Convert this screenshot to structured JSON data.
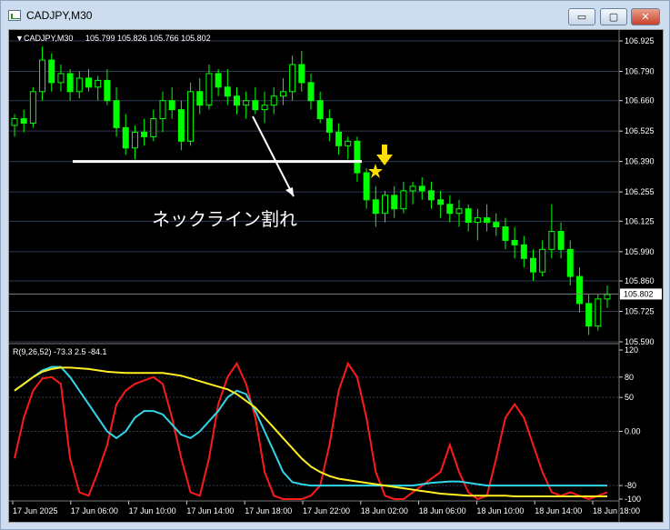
{
  "window": {
    "title": "CADJPY,M30",
    "min_label": "▭",
    "max_label": "▢",
    "close_label": "✕"
  },
  "colors": {
    "bull": "#00ff00",
    "bear": "#000000",
    "grid": "#2e3b54",
    "red": "#ff1a1a",
    "cyan": "#33d6e6",
    "yellow": "#ffee22",
    "white": "#ffffff"
  },
  "chart": {
    "symbol_label": "CADJPY,M30",
    "ohlc": "105.799 105.826 105.766 105.802",
    "current_price": "105.802",
    "annotation": "ネックライン割れ",
    "price_ticks": [
      "106.925",
      "106.790",
      "106.660",
      "106.525",
      "106.390",
      "106.255",
      "106.125",
      "105.990",
      "105.860",
      "105.725",
      "105.590"
    ],
    "indicator_label": "R(9,26,52) -73.3 2.5 -84.1",
    "indicator_ticks": [
      "120",
      "80",
      "50",
      "0.00",
      "-80",
      "-100"
    ],
    "time_ticks": [
      "17 Jun 2025",
      "17 Jun 06:00",
      "17 Jun 10:00",
      "17 Jun 14:00",
      "17 Jun 18:00",
      "17 Jun 22:00",
      "18 Jun 02:00",
      "18 Jun 06:00",
      "18 Jun 10:00",
      "18 Jun 14:00",
      "18 Jun 18:00"
    ]
  },
  "chart_data": {
    "type": "candlestick",
    "symbol": "CADJPY",
    "timeframe": "M30",
    "ylim": [
      105.59,
      106.925
    ],
    "neckline": 106.39,
    "candles": [
      [
        106.55,
        106.6,
        106.5,
        106.58
      ],
      [
        106.58,
        106.62,
        106.52,
        106.56
      ],
      [
        106.56,
        106.72,
        106.54,
        106.7
      ],
      [
        106.7,
        106.9,
        106.66,
        106.84
      ],
      [
        106.84,
        106.87,
        106.7,
        106.74
      ],
      [
        106.74,
        106.82,
        106.7,
        106.78
      ],
      [
        106.78,
        106.8,
        106.66,
        106.7
      ],
      [
        106.7,
        106.79,
        106.67,
        106.76
      ],
      [
        106.76,
        106.8,
        106.7,
        106.72
      ],
      [
        106.72,
        106.77,
        106.66,
        106.75
      ],
      [
        106.75,
        106.8,
        106.64,
        106.66
      ],
      [
        106.66,
        106.72,
        106.5,
        106.54
      ],
      [
        106.54,
        106.6,
        106.42,
        106.45
      ],
      [
        106.45,
        106.55,
        106.4,
        106.52
      ],
      [
        106.52,
        106.58,
        106.46,
        106.5
      ],
      [
        106.5,
        106.62,
        106.48,
        106.58
      ],
      [
        106.58,
        106.7,
        106.52,
        106.66
      ],
      [
        106.66,
        106.72,
        106.58,
        106.62
      ],
      [
        106.62,
        106.66,
        106.44,
        106.48
      ],
      [
        106.48,
        106.74,
        106.46,
        106.7
      ],
      [
        106.7,
        106.76,
        106.6,
        106.64
      ],
      [
        106.64,
        106.82,
        106.62,
        106.78
      ],
      [
        106.78,
        106.8,
        106.68,
        106.72
      ],
      [
        106.72,
        106.8,
        106.64,
        106.68
      ],
      [
        106.68,
        106.72,
        106.6,
        106.64
      ],
      [
        106.64,
        106.7,
        106.58,
        106.66
      ],
      [
        106.66,
        106.72,
        106.6,
        106.62
      ],
      [
        106.62,
        106.7,
        106.56,
        106.64
      ],
      [
        106.64,
        106.72,
        106.6,
        106.68
      ],
      [
        106.68,
        106.76,
        106.64,
        106.7
      ],
      [
        106.7,
        106.86,
        106.66,
        106.82
      ],
      [
        106.82,
        106.88,
        106.7,
        106.74
      ],
      [
        106.74,
        106.78,
        106.62,
        106.66
      ],
      [
        106.66,
        106.7,
        106.56,
        106.58
      ],
      [
        106.58,
        106.62,
        106.48,
        106.52
      ],
      [
        106.52,
        106.56,
        106.42,
        106.46
      ],
      [
        106.46,
        106.5,
        106.4,
        106.48
      ],
      [
        106.48,
        106.5,
        106.3,
        106.34
      ],
      [
        106.34,
        106.36,
        106.18,
        106.22
      ],
      [
        106.22,
        106.28,
        106.1,
        106.16
      ],
      [
        106.16,
        106.26,
        106.12,
        106.24
      ],
      [
        106.24,
        106.28,
        106.14,
        106.18
      ],
      [
        106.18,
        106.3,
        106.16,
        106.26
      ],
      [
        106.26,
        106.3,
        106.2,
        106.28
      ],
      [
        106.28,
        106.32,
        106.22,
        106.26
      ],
      [
        106.26,
        106.3,
        106.18,
        106.22
      ],
      [
        106.22,
        106.26,
        106.14,
        106.2
      ],
      [
        106.2,
        106.24,
        106.12,
        106.16
      ],
      [
        106.16,
        106.22,
        106.1,
        106.18
      ],
      [
        106.18,
        106.2,
        106.08,
        106.12
      ],
      [
        106.12,
        106.18,
        106.04,
        106.14
      ],
      [
        106.14,
        106.2,
        106.08,
        106.12
      ],
      [
        106.12,
        106.16,
        106.06,
        106.1
      ],
      [
        106.1,
        106.14,
        106.0,
        106.04
      ],
      [
        106.04,
        106.1,
        105.96,
        106.02
      ],
      [
        106.02,
        106.06,
        105.92,
        105.96
      ],
      [
        105.96,
        106.0,
        105.86,
        105.9
      ],
      [
        105.9,
        106.04,
        105.88,
        106.0
      ],
      [
        106.0,
        106.2,
        105.96,
        106.08
      ],
      [
        106.08,
        106.12,
        105.96,
        106.0
      ],
      [
        106.0,
        106.04,
        105.84,
        105.88
      ],
      [
        105.88,
        105.92,
        105.72,
        105.76
      ],
      [
        105.76,
        105.8,
        105.62,
        105.66
      ],
      [
        105.66,
        105.8,
        105.64,
        105.78
      ],
      [
        105.78,
        105.84,
        105.74,
        105.8
      ]
    ],
    "indicator": {
      "name": "R(9,26,52)",
      "values": [
        -73.3,
        2.5,
        -84.1
      ],
      "ylim": [
        -100,
        120
      ],
      "series": [
        {
          "color": "red",
          "values": [
            -40,
            20,
            60,
            78,
            80,
            70,
            -40,
            -90,
            -95,
            -60,
            -20,
            40,
            60,
            70,
            75,
            80,
            70,
            20,
            -40,
            -90,
            -95,
            -40,
            40,
            80,
            100,
            70,
            20,
            -60,
            -95,
            -100,
            -100,
            -100,
            -95,
            -80,
            -20,
            60,
            100,
            80,
            20,
            -60,
            -95,
            -100,
            -100,
            -90,
            -80,
            -70,
            -60,
            -20,
            -60,
            -90,
            -100,
            -95,
            -40,
            20,
            40,
            20,
            -20,
            -60,
            -90,
            -95,
            -90,
            -95,
            -100,
            -95,
            -90
          ]
        },
        {
          "color": "cyan",
          "values": [
            60,
            70,
            80,
            90,
            95,
            95,
            80,
            60,
            40,
            20,
            0,
            -10,
            0,
            20,
            30,
            30,
            25,
            10,
            -5,
            -10,
            0,
            15,
            30,
            50,
            60,
            55,
            30,
            0,
            -30,
            -60,
            -75,
            -78,
            -80,
            -80,
            -80,
            -80,
            -80,
            -80,
            -80,
            -80,
            -80,
            -80,
            -80,
            -80,
            -78,
            -76,
            -75,
            -74,
            -74,
            -76,
            -78,
            -80,
            -80,
            -80,
            -80,
            -80,
            -80,
            -80,
            -80,
            -80,
            -80,
            -80,
            -80,
            -80,
            -80
          ]
        },
        {
          "color": "yellow",
          "values": [
            60,
            70,
            80,
            88,
            92,
            94,
            94,
            93,
            92,
            90,
            88,
            87,
            86,
            86,
            86,
            86,
            86,
            84,
            82,
            78,
            74,
            70,
            66,
            62,
            55,
            45,
            35,
            20,
            5,
            -10,
            -25,
            -40,
            -52,
            -60,
            -66,
            -70,
            -72,
            -74,
            -76,
            -78,
            -80,
            -82,
            -84,
            -86,
            -88,
            -90,
            -92,
            -93,
            -94,
            -95,
            -95,
            -95,
            -95,
            -95,
            -96,
            -96,
            -96,
            -96,
            -96,
            -96,
            -96,
            -96,
            -96,
            -96,
            -96
          ]
        }
      ]
    }
  }
}
